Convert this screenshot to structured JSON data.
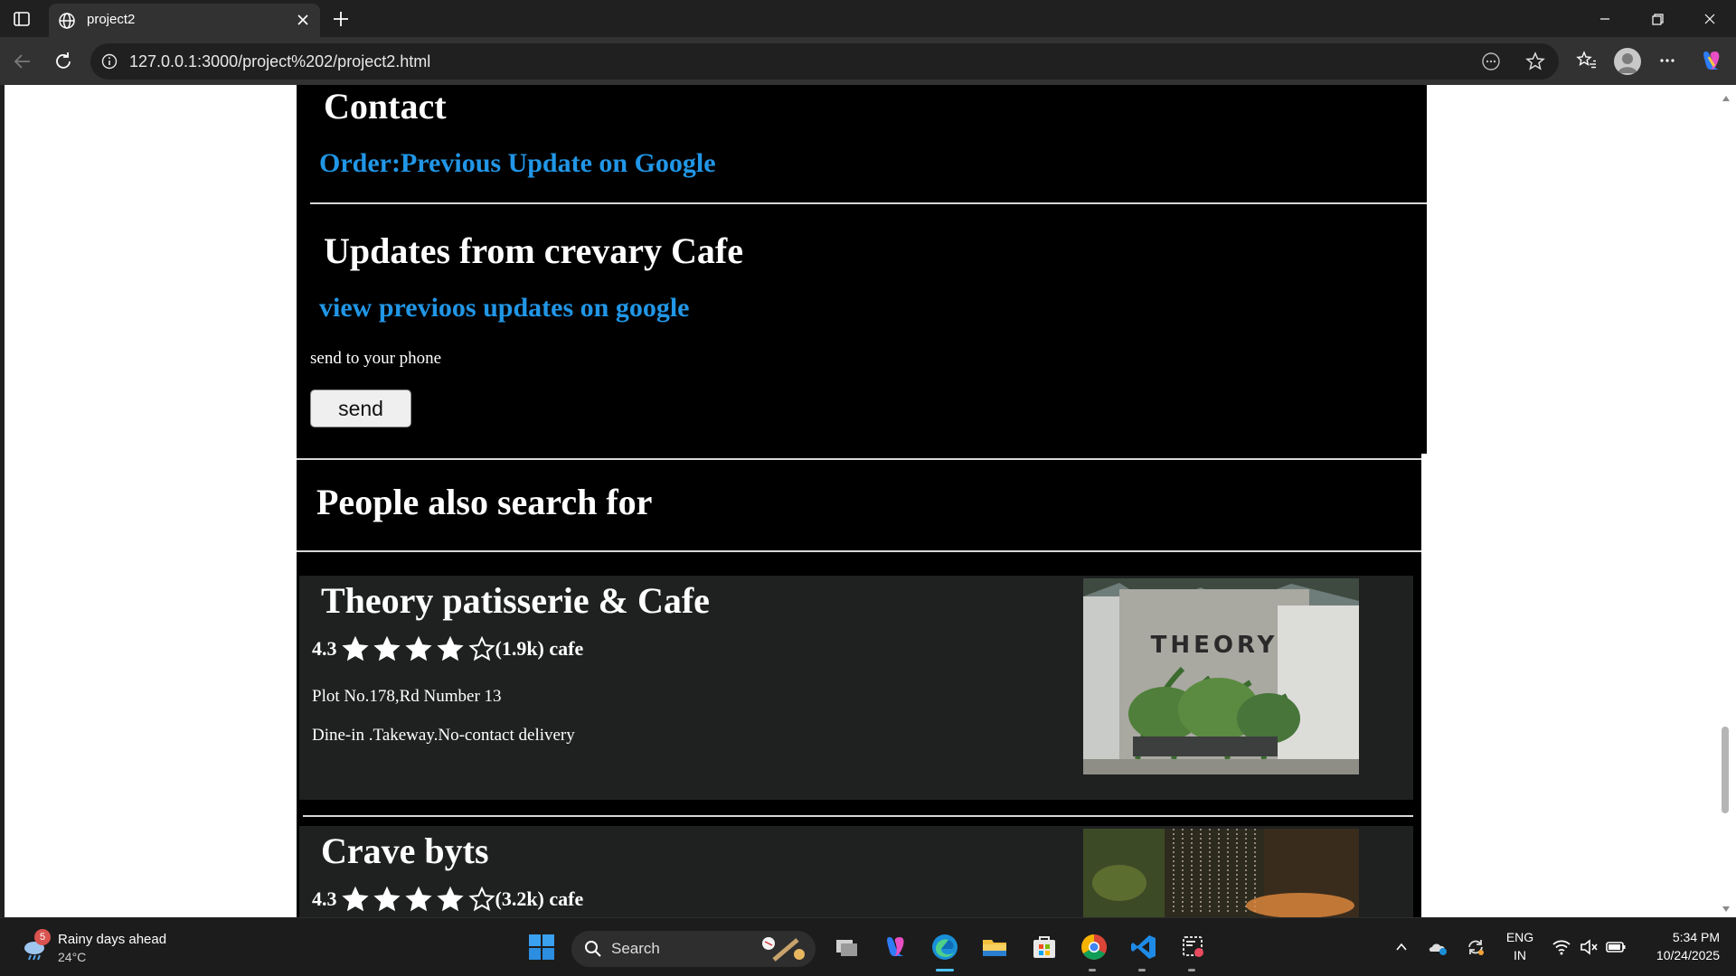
{
  "browser": {
    "tab_title": "project2",
    "url": "127.0.0.1:3000/project%202/project2.html"
  },
  "page": {
    "contact_heading": "Contact",
    "order_link": "Order:Previous Update on Google",
    "updates_heading": "Updates from crevary Cafe",
    "updates_link": "view previoos updates on google",
    "send_label": "send to your phone",
    "send_button": "send",
    "people_heading": "People also search for",
    "cards": [
      {
        "name": "Theory patisserie & Cafe",
        "rating": "4.3",
        "stars_filled": 4,
        "stars_total": 5,
        "reviews": "(1.9k) cafe",
        "address": "Plot No.178,Rd Number 13",
        "services": "Dine-in .Takeway.No-contact delivery",
        "image_text": "THEORY"
      },
      {
        "name": "Crave byts",
        "rating": "4.3",
        "stars_filled": 4,
        "stars_total": 5,
        "reviews": "(3.2k) cafe"
      }
    ]
  },
  "taskbar": {
    "weather_badge": "5",
    "weather_title": "Rainy days ahead",
    "weather_temp": "24°C",
    "search_placeholder": "Search",
    "lang_top": "ENG",
    "lang_bottom": "IN",
    "time": "5:34 PM",
    "date": "10/24/2025"
  },
  "colors": {
    "link": "#2196e6",
    "page_bg": "#000000",
    "card_bg": "#1f2121"
  }
}
